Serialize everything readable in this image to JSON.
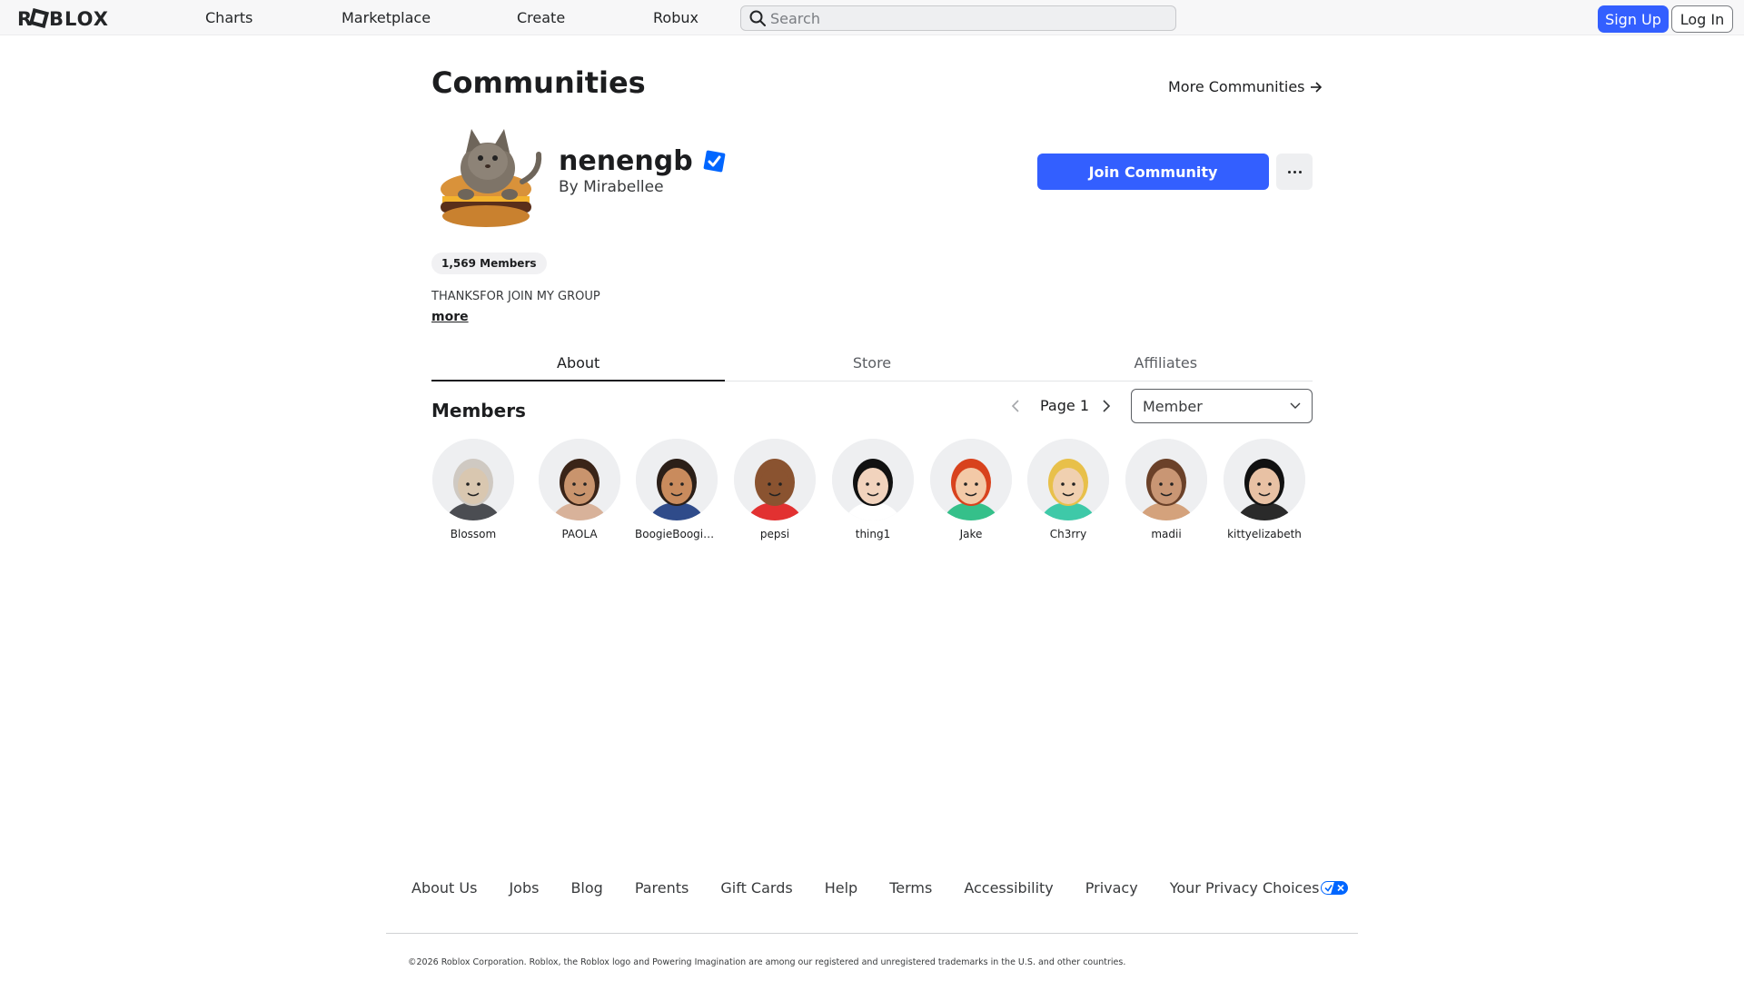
{
  "header": {
    "logo_text": "ROBLOX",
    "nav": [
      "Charts",
      "Marketplace",
      "Create",
      "Robux"
    ],
    "search_placeholder": "Search",
    "sign_up": "Sign Up",
    "log_in": "Log In"
  },
  "page": {
    "title": "Communities",
    "more_communities": "More Communities"
  },
  "group": {
    "name": "nenengb",
    "owner_prefix": "By",
    "owner": "Mirabellee",
    "join_button": "Join Community",
    "member_count": "1,569 Members",
    "description": "THANKSFOR JOIN MY GROUP",
    "more_link": "more"
  },
  "tabs": [
    {
      "label": "About",
      "active": true
    },
    {
      "label": "Store",
      "active": false
    },
    {
      "label": "Affiliates",
      "active": false
    }
  ],
  "members_section": {
    "title": "Members",
    "page_label": "Page 1",
    "role_selected": "Member",
    "members": [
      {
        "name": "Blossom",
        "skin": "#d9c7b0",
        "hair": "#cfc9c2",
        "shirt": "#4b4d52"
      },
      {
        "name": "PAOLA",
        "skin": "#c9946d",
        "hair": "#3a2418",
        "shirt": "#d8b29a"
      },
      {
        "name": "BoogieBoogie…",
        "skin": "#c98b5d",
        "hair": "#2b1f18",
        "shirt": "#2f4b8a"
      },
      {
        "name": "pepsi",
        "skin": "#8a5330",
        "hair": "#8a5330",
        "shirt": "#e23131"
      },
      {
        "name": "thing1",
        "skin": "#f1d3bd",
        "hair": "#111111",
        "shirt": "#ffffff"
      },
      {
        "name": "Jake",
        "skin": "#f3c9a7",
        "hair": "#d8421d",
        "shirt": "#35c08a"
      },
      {
        "name": "Ch3rry",
        "skin": "#f0d0b0",
        "hair": "#e8c04a",
        "shirt": "#3ec9a8"
      },
      {
        "name": "madii",
        "skin": "#c99674",
        "hair": "#6b4129",
        "shirt": "#d4a27c"
      },
      {
        "name": "kittyelizabeth",
        "skin": "#e8c1a4",
        "hair": "#111111",
        "shirt": "#2a2a2a"
      }
    ]
  },
  "footer": {
    "links": [
      "About Us",
      "Jobs",
      "Blog",
      "Parents",
      "Gift Cards",
      "Help",
      "Terms",
      "Accessibility",
      "Privacy",
      "Your Privacy Choices"
    ],
    "copyright": "©2026 Roblox Corporation. Roblox, the Roblox logo and Powering Imagination are among our registered and unregistered trademarks in the U.S. and other countries."
  },
  "colors": {
    "accent": "#335fff",
    "verified": "#0066ff",
    "text": "#1c1d1f"
  }
}
